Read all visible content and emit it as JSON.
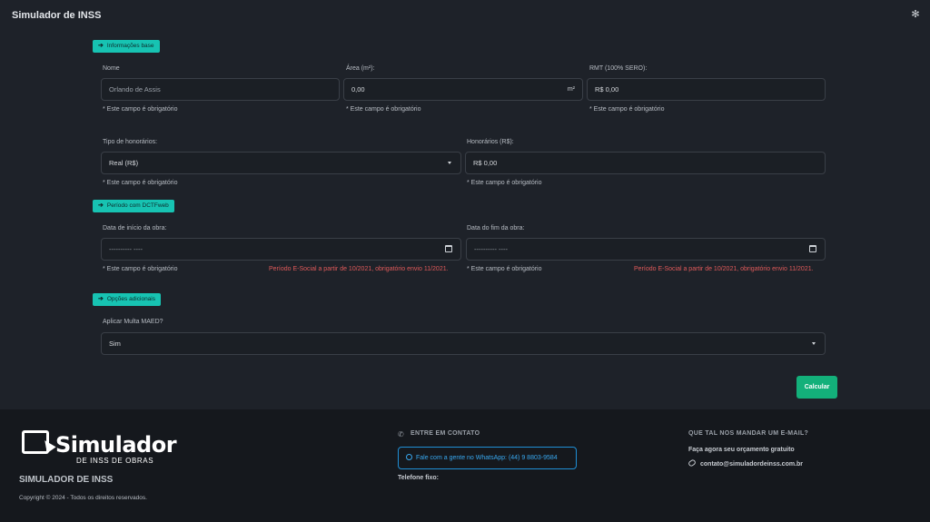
{
  "app": {
    "title": "Simulador de INSS"
  },
  "sections": {
    "base": "Informações base",
    "period": "Período com DCTFweb",
    "options": "Opções adicionais"
  },
  "form": {
    "nome": {
      "label": "Nome",
      "value": "Orlando de Assis",
      "hint": "* Este campo é obrigatório"
    },
    "area": {
      "label": "Área (m²):",
      "value": "0,00",
      "suffix": "m²",
      "hint": "* Este campo é obrigatório"
    },
    "rmt": {
      "label": "RMT (100% SERO):",
      "value": "R$ 0,00",
      "hint": "* Este campo é obrigatório"
    },
    "tipo_honorarios": {
      "label": "Tipo de honorários:",
      "value": "Real (R$)",
      "hint": "* Este campo é obrigatório"
    },
    "honorarios": {
      "label": "Honorários (R$):",
      "value": "R$ 0,00",
      "hint": "* Este campo é obrigatório"
    },
    "data_inicio": {
      "label": "Data de início da obra:",
      "placeholder": "---------- ----",
      "hint": "* Este campo é obrigatório",
      "warning": "Período E-Social a partir de 10/2021, obrigatório envio 11/2021."
    },
    "data_fim": {
      "label": "Data do fim da obra:",
      "placeholder": "---------- ----",
      "hint": "* Este campo é obrigatório",
      "warning": "Período E-Social a partir de 10/2021, obrigatório envio 11/2021."
    },
    "multa": {
      "label": "Aplicar Multa MAED?",
      "value": "Sim"
    }
  },
  "actions": {
    "calculate": "Calcular"
  },
  "footer": {
    "logo_big": "Simulador",
    "logo_small": "DE INSS DE OBRAS",
    "brand": "SIMULADOR DE INSS",
    "copyright": "Copyright © 2024 - Todos os direitos reservados.",
    "contact_heading": "ENTRE EM CONTATO",
    "whatsapp": "Fale com a gente no WhatsApp: (44) 9 8803-9584",
    "phone_label": "Telefone fixo:",
    "email_heading": "QUE TAL NOS MANDAR UM E-MAIL?",
    "email_subtitle": "Faça agora seu orçamento gratuito",
    "email": "contato@simuladordeinss.com.br"
  },
  "icons": {
    "settings": "gear-icon",
    "arrow": "arrow-right-icon",
    "phone": "phone-icon",
    "whatsapp": "whatsapp-icon",
    "link": "link-icon",
    "calendar": "calendar-icon"
  }
}
